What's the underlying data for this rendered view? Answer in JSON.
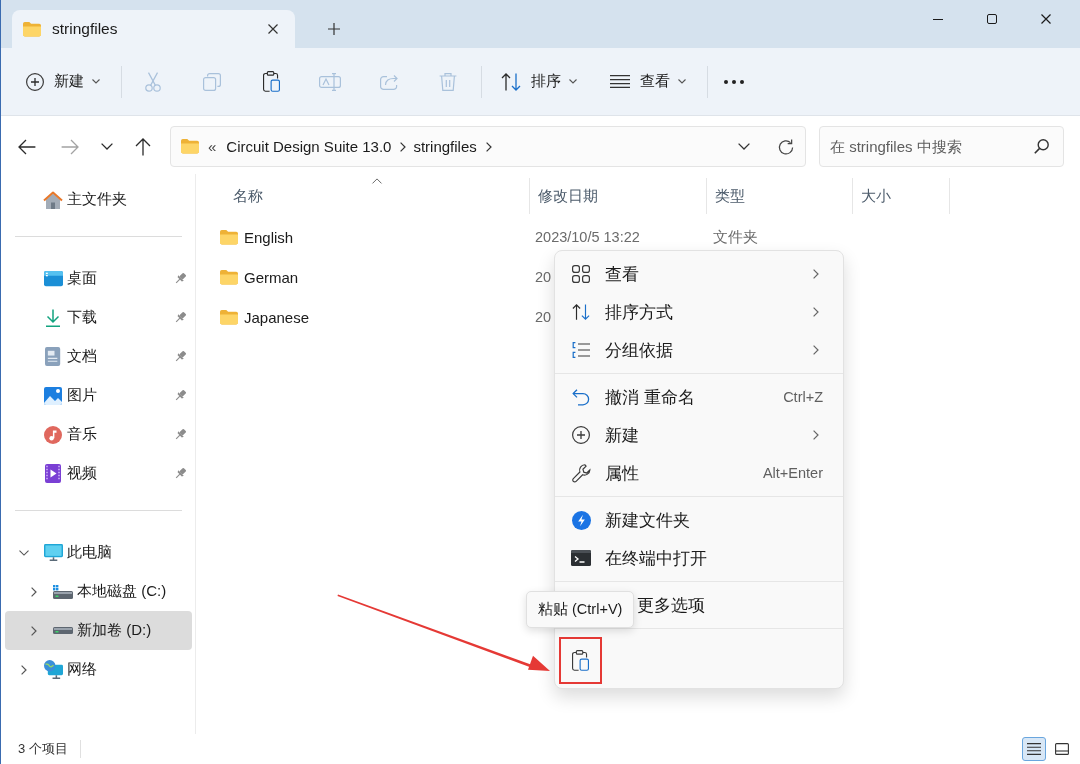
{
  "window": {
    "tabs": [
      {
        "title": "stringfiles",
        "selected": true
      }
    ]
  },
  "toolbar": {
    "new_button": {
      "label": "新建"
    },
    "actions": [
      {
        "kind": "cut",
        "disabled": true
      },
      {
        "kind": "copy",
        "disabled": true
      },
      {
        "kind": "paste",
        "disabled": false
      },
      {
        "kind": "rename",
        "disabled": true
      },
      {
        "kind": "share",
        "disabled": true
      },
      {
        "kind": "delete",
        "disabled": true
      }
    ],
    "sort_button": {
      "label": "排序"
    },
    "view_button": {
      "label": "查看"
    }
  },
  "navigation": [
    {
      "kind": "back",
      "disabled": false
    },
    {
      "kind": "forward",
      "disabled": true
    },
    {
      "kind": "recent",
      "disabled": false
    },
    {
      "kind": "up",
      "disabled": false
    }
  ],
  "address_bar": {
    "overflow": "«",
    "path": [
      "Circuit Design Suite 13.0",
      "stringfiles"
    ]
  },
  "search": {
    "placeholder": "在 stringfiles 中搜索"
  },
  "sidebar": {
    "sections": [
      [
        {
          "kind": "home",
          "label": "主文件夹",
          "selected": false
        }
      ],
      [
        {
          "kind": "desktop",
          "label": "桌面",
          "pinned": true,
          "selected": false
        },
        {
          "kind": "download",
          "label": "下载",
          "pinned": true,
          "selected": false
        },
        {
          "kind": "documents",
          "label": "文档",
          "pinned": true,
          "selected": false
        },
        {
          "kind": "pictures",
          "label": "图片",
          "pinned": true,
          "selected": false
        },
        {
          "kind": "music",
          "label": "音乐",
          "pinned": true,
          "selected": false
        },
        {
          "kind": "videos",
          "label": "视频",
          "pinned": true,
          "selected": false
        }
      ],
      [
        {
          "kind": "pc",
          "label": "此电脑",
          "expanded": true,
          "selected": false,
          "children": [
            {
              "kind": "system_drive",
              "label": "本地磁盘 (C:)",
              "expanded": false,
              "selected": false
            },
            {
              "kind": "drive",
              "label": "新加卷 (D:)",
              "expanded": false,
              "selected": true
            }
          ]
        },
        {
          "kind": "network",
          "label": "网络",
          "expanded": false,
          "selected": false
        }
      ]
    ]
  },
  "file_list": {
    "columns": [
      {
        "label": "名称",
        "sorted": true
      },
      {
        "label": "修改日期",
        "sorted": false
      },
      {
        "label": "类型",
        "sorted": false
      },
      {
        "label": "大小",
        "sorted": false
      }
    ],
    "rows": [
      {
        "name": "English",
        "modified": "2023/10/5 13:22",
        "type": "文件夹"
      },
      {
        "name": "German",
        "modified": "20"
      },
      {
        "name": "Japanese",
        "modified": "20"
      }
    ]
  },
  "context_menu": {
    "groups": [
      [
        {
          "kind": "view",
          "label": "查看",
          "submenu": true
        },
        {
          "kind": "sort",
          "label": "排序方式",
          "submenu": true
        },
        {
          "kind": "group",
          "label": "分组依据",
          "submenu": true
        }
      ],
      [
        {
          "kind": "undo",
          "label": "撤消 重命名",
          "shortcut": "Ctrl+Z",
          "submenu": false
        },
        {
          "kind": "new",
          "label": "新建",
          "submenu": true
        },
        {
          "kind": "properties",
          "label": "属性",
          "shortcut": "Alt+Enter",
          "submenu": false
        }
      ],
      [
        {
          "kind": "new_folder",
          "label": "新建文件夹",
          "submenu": false
        },
        {
          "kind": "terminal",
          "label": "在终端中打开",
          "submenu": false
        }
      ],
      [
        {
          "kind": "more",
          "label": "更多选项",
          "submenu": false
        }
      ]
    ],
    "bottom_actions": [
      {
        "kind": "paste",
        "tooltip": "粘贴 (Ctrl+V)",
        "highlighted": true
      }
    ]
  },
  "status_bar": {
    "item_count": "3 个项目",
    "views": [
      {
        "kind": "details",
        "selected": true
      },
      {
        "kind": "tiles",
        "selected": false
      }
    ]
  }
}
